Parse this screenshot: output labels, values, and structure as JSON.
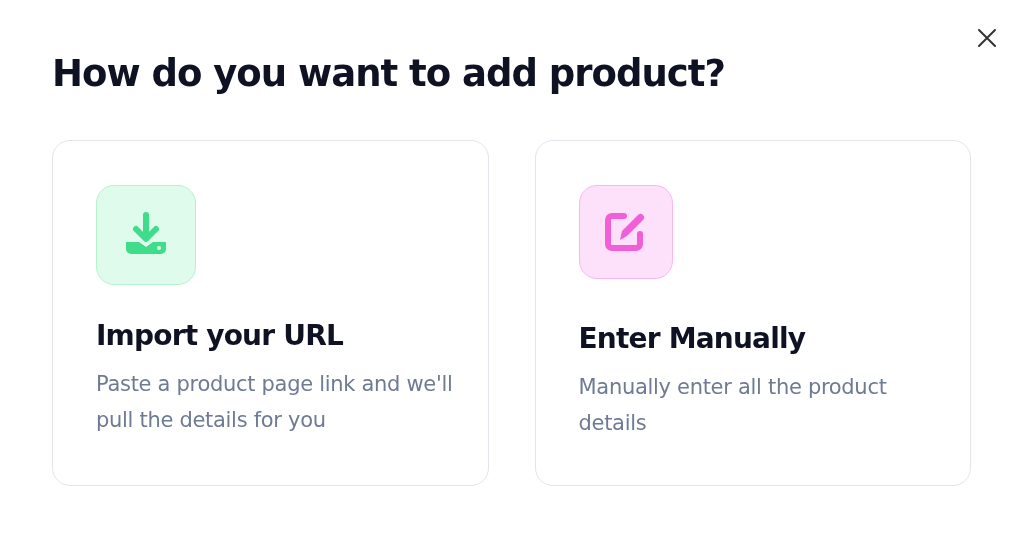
{
  "dialog": {
    "title": "How do you want to add product?"
  },
  "options": [
    {
      "kind": "import",
      "title": "Import your URL",
      "description": "Paste a product page link and we'll pull the details for you"
    },
    {
      "kind": "manual",
      "title": "Enter Manually",
      "description": "Manually enter all the product details"
    }
  ]
}
